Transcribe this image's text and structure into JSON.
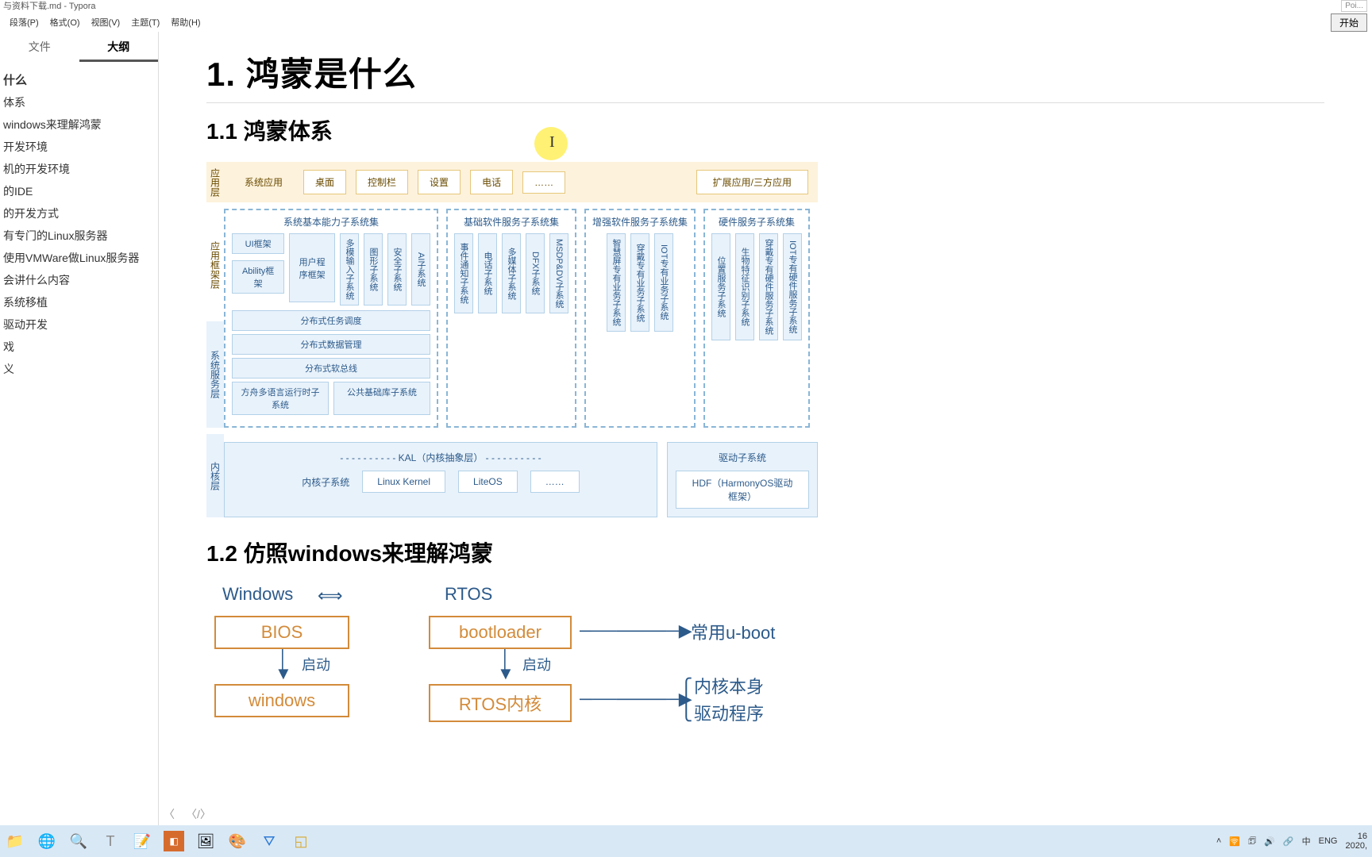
{
  "window": {
    "title": "与资料下载.md - Typora"
  },
  "menu": {
    "items": [
      "段落(P)",
      "格式(O)",
      "视图(V)",
      "主题(T)",
      "帮助(H)"
    ]
  },
  "topright": {
    "poi": "Poi...",
    "start": "开始"
  },
  "sidebar": {
    "tabs": [
      {
        "label": "文件"
      },
      {
        "label": "大纲"
      }
    ],
    "outline": [
      {
        "label": "什么",
        "level": "h1"
      },
      {
        "label": "体系",
        "level": "h2"
      },
      {
        "label": "windows来理解鸿蒙",
        "level": "h2"
      },
      {
        "label": "开发环境",
        "level": "h1"
      },
      {
        "label": "机的开发环境",
        "level": "h2"
      },
      {
        "label": "的IDE",
        "level": "h2"
      },
      {
        "label": "的开发方式",
        "level": "h2"
      },
      {
        "label": "有专门的Linux服务器",
        "level": "h2"
      },
      {
        "label": "使用VMWare做Linux服务器",
        "level": "h2"
      },
      {
        "label": "会讲什么内容",
        "level": "h1"
      },
      {
        "label": "系统移植",
        "level": "h2"
      },
      {
        "label": "驱动开发",
        "level": "h2"
      },
      {
        "label": "戏",
        "level": "h2"
      },
      {
        "label": "义",
        "level": "h2"
      }
    ]
  },
  "doc": {
    "h1": "1. 鸿蒙是什么",
    "h2a": "1.1 鸿蒙体系",
    "h2b": "1.2 仿照windows来理解鸿蒙"
  },
  "diagram1": {
    "layers": {
      "app": "应用层",
      "fw": "应用框架层",
      "svc": "系统服务层",
      "kernel": "内核层"
    },
    "app": {
      "title": "系统应用",
      "items": [
        "桌面",
        "控制栏",
        "设置",
        "电话",
        "……"
      ],
      "ext": "扩展应用/三方应用"
    },
    "fw_groups": [
      {
        "title": "系统基本能力子系统集",
        "small": [
          "UI框架",
          "Ability框架"
        ],
        "small2": "用户程序框架",
        "vcols": [
          "多模输入子系统",
          "图形子系统",
          "安全子系统",
          "AI子系统"
        ]
      },
      {
        "title": "基础软件服务子系统集",
        "vcols": [
          "事件通知子系统",
          "电话子系统",
          "多媒体子系统",
          "DFX子系统",
          "MSDP&DV子系统"
        ]
      },
      {
        "title": "增强软件服务子系统集",
        "vcols": [
          "智慧屏专有业务子系统",
          "穿戴专有业务子系统",
          "IOT专有业务子系统"
        ]
      },
      {
        "title": "硬件服务子系统集",
        "vcols": [
          "位置服务子系统",
          "生物特征识别子系统",
          "穿戴专有硬件服务子系统",
          "IOT专有硬件服务子系统"
        ]
      }
    ],
    "svc": {
      "items": [
        "分布式任务调度",
        "分布式数据管理",
        "分布式软总线",
        "方舟多语言运行时子系统"
      ],
      "item2": "公共基础库子系统"
    },
    "kernel": {
      "kal": "KAL（内核抽象层）",
      "sub": "内核子系统",
      "boxes": [
        "Linux Kernel",
        "LiteOS",
        "……"
      ],
      "drv": "驱动子系统",
      "hdf": "HDF（HarmonyOS驱动框架）"
    }
  },
  "diagram2": {
    "windows": "Windows",
    "rtos": "RTOS",
    "bios": "BIOS",
    "bootloader": "bootloader",
    "uboot": "常用u-boot",
    "boot": "启动",
    "win": "windows",
    "rtoskernel": "RTOS内核",
    "kernelself": "内核本身",
    "driver": "驱动程序"
  },
  "taskbar": {
    "tray": {
      "ime": "中",
      "lang": "ENG",
      "time": "16",
      "date": "2020,"
    }
  }
}
